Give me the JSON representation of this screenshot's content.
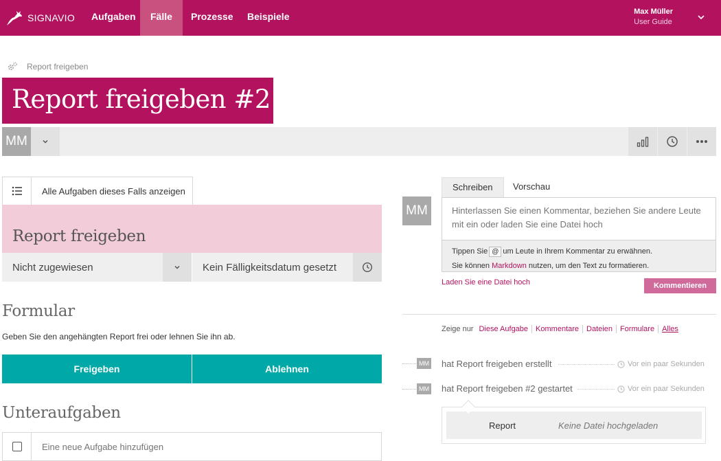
{
  "brand": {
    "name": "SIGNAVIO",
    "color": "#b3125f"
  },
  "nav": {
    "items": [
      {
        "label": "Aufgaben",
        "active": false
      },
      {
        "label": "Fälle",
        "active": true
      },
      {
        "label": "Prozesse",
        "active": false
      },
      {
        "label": "Beispiele",
        "active": false
      }
    ]
  },
  "user": {
    "name": "Max Müller",
    "subtitle": "User Guide"
  },
  "breadcrumb": {
    "label": "Report freigeben"
  },
  "case": {
    "title": "Report freigeben #2",
    "assignee_initials": "MM",
    "show_all_label": "Alle Aufgaben dieses Falls anzeigen"
  },
  "task": {
    "title": "Report freigeben",
    "assignee": "Nicht zugewiesen",
    "due_date": "Kein Fälligkeitsdatum gesetzt"
  },
  "form": {
    "heading": "Formular",
    "description": "Geben Sie den angehängten Report frei oder lehnen Sie ihn ab.",
    "approve_label": "Freigeben",
    "reject_label": "Ablehnen"
  },
  "subtasks": {
    "heading": "Unteraufgaben",
    "placeholder": "Eine neue Aufgabe hinzufügen"
  },
  "comments": {
    "avatar_initials": "MM",
    "tabs": [
      {
        "label": "Schreiben",
        "active": true
      },
      {
        "label": "Vorschau",
        "active": false
      }
    ],
    "placeholder": "Hinterlassen Sie einen Kommentar, beziehen Sie andere Leute mit ein oder laden Sie eine Datei hoch",
    "help_line1_pre": "Tippen Sie",
    "help_at": "@",
    "help_line1_post": "um Leute in Ihrem Kommentar zu erwähnen.",
    "help_line2_pre": "Sie können",
    "help_line2_link": "Markdown",
    "help_line2_post": "nutzen, um den Text zu formatieren.",
    "upload_link": "Laden Sie eine Datei hoch",
    "submit_label": "Kommentieren"
  },
  "filter": {
    "prefix": "Zeige nur",
    "options": [
      "Diese Aufgabe",
      "Kommentare",
      "Dateien",
      "Formulare",
      "Alles"
    ],
    "selected": "Alles"
  },
  "activity": [
    {
      "initials": "MM",
      "text": "hat Report freigeben erstellt",
      "time": "Vor ein paar Sekunden"
    },
    {
      "initials": "MM",
      "text": "hat Report freigeben #2 gestartet",
      "time": "Vor ein paar Sekunden"
    }
  ],
  "attachment": {
    "label": "Report",
    "status": "Keine Datei hochgeladen"
  },
  "colors": {
    "accent": "#b3125f",
    "nav_active": "#c8517f",
    "task_header": "#f2ccd8",
    "teal": "#00a8a8",
    "comment_button": "#d06a9a"
  }
}
